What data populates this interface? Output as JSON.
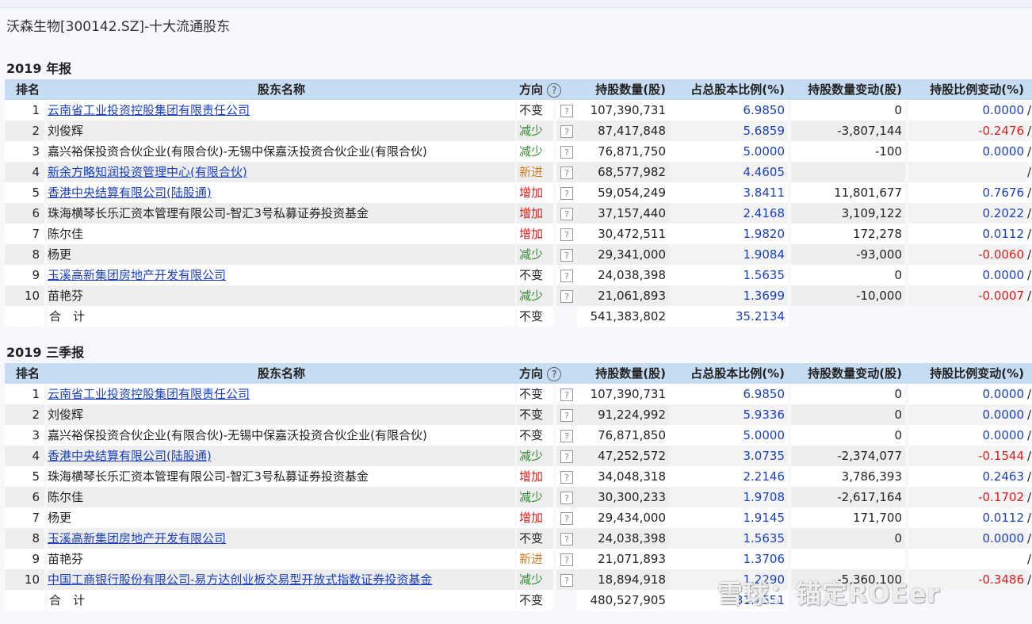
{
  "page_title": "沃森生物[300142.SZ]-十大流通股东",
  "headers": {
    "rank": "排名",
    "name": "股东名称",
    "direction": "方向",
    "help": "?",
    "shares": "持股数量(股)",
    "ratio": "占总股本比例(%)",
    "shares_change": "持股数量变动(股)",
    "ratio_change": "持股比例变动(%)"
  },
  "sections": [
    {
      "title": "2019 年报",
      "rows": [
        {
          "rank": "1",
          "name": "云南省工业投资控股集团有限责任公司",
          "link": true,
          "direction": "不变",
          "dir_color": "dim",
          "shares": "107,390,731",
          "ratio": "6.9850",
          "shares_change": "0",
          "ratio_change": "0.0000",
          "rc_color": "blue",
          "tail": "/"
        },
        {
          "rank": "2",
          "name": "刘俊辉",
          "link": false,
          "direction": "减少",
          "dir_color": "green",
          "shares": "87,417,848",
          "ratio": "5.6859",
          "shares_change": "-3,807,144",
          "ratio_change": "-0.2476",
          "rc_color": "red",
          "tail": "/"
        },
        {
          "rank": "3",
          "name": "嘉兴裕保投资合伙企业(有限合伙)-无锡中保嘉沃投资合伙企业(有限合伙)",
          "link": false,
          "direction": "减少",
          "dir_color": "green",
          "shares": "76,871,750",
          "ratio": "5.0000",
          "shares_change": "-100",
          "ratio_change": "0.0000",
          "rc_color": "blue",
          "tail": "/"
        },
        {
          "rank": "4",
          "name": "新余方略知润投资管理中心(有限合伙)",
          "link": true,
          "direction": "新进",
          "dir_color": "orange",
          "shares": "68,577,982",
          "ratio": "4.4605",
          "shares_change": "",
          "ratio_change": "",
          "rc_color": "blue",
          "tail": "/"
        },
        {
          "rank": "5",
          "name": "香港中央结算有限公司(陆股通)",
          "link": true,
          "direction": "增加",
          "dir_color": "red",
          "shares": "59,054,249",
          "ratio": "3.8411",
          "shares_change": "11,801,677",
          "ratio_change": "0.7676",
          "rc_color": "blue",
          "tail": "/"
        },
        {
          "rank": "6",
          "name": "珠海横琴长乐汇资本管理有限公司-智汇3号私募证券投资基金",
          "link": false,
          "direction": "增加",
          "dir_color": "red",
          "shares": "37,157,440",
          "ratio": "2.4168",
          "shares_change": "3,109,122",
          "ratio_change": "0.2022",
          "rc_color": "blue",
          "tail": "/"
        },
        {
          "rank": "7",
          "name": "陈尔佳",
          "link": false,
          "direction": "增加",
          "dir_color": "red",
          "shares": "30,472,511",
          "ratio": "1.9820",
          "shares_change": "172,278",
          "ratio_change": "0.0112",
          "rc_color": "blue",
          "tail": "/"
        },
        {
          "rank": "8",
          "name": "杨更",
          "link": false,
          "direction": "减少",
          "dir_color": "green",
          "shares": "29,341,000",
          "ratio": "1.9084",
          "shares_change": "-93,000",
          "ratio_change": "-0.0060",
          "rc_color": "red",
          "tail": "/"
        },
        {
          "rank": "9",
          "name": "玉溪高新集团房地产开发有限公司",
          "link": true,
          "direction": "不变",
          "dir_color": "dim",
          "shares": "24,038,398",
          "ratio": "1.5635",
          "shares_change": "0",
          "ratio_change": "0.0000",
          "rc_color": "blue",
          "tail": "/"
        },
        {
          "rank": "10",
          "name": "苗艳芬",
          "link": false,
          "direction": "减少",
          "dir_color": "green",
          "shares": "21,061,893",
          "ratio": "1.3699",
          "shares_change": "-10,000",
          "ratio_change": "-0.0007",
          "rc_color": "red",
          "tail": "/"
        }
      ],
      "total": {
        "label": "合　计",
        "direction": "不变",
        "shares": "541,383,802",
        "ratio": "35.2134"
      }
    },
    {
      "title": "2019 三季报",
      "rows": [
        {
          "rank": "1",
          "name": "云南省工业投资控股集团有限责任公司",
          "link": true,
          "direction": "不变",
          "dir_color": "dim",
          "shares": "107,390,731",
          "ratio": "6.9850",
          "shares_change": "0",
          "ratio_change": "0.0000",
          "rc_color": "blue",
          "tail": "/"
        },
        {
          "rank": "2",
          "name": "刘俊辉",
          "link": false,
          "direction": "不变",
          "dir_color": "dim",
          "shares": "91,224,992",
          "ratio": "5.9336",
          "shares_change": "0",
          "ratio_change": "0.0000",
          "rc_color": "blue",
          "tail": "/"
        },
        {
          "rank": "3",
          "name": "嘉兴裕保投资合伙企业(有限合伙)-无锡中保嘉沃投资合伙企业(有限合伙)",
          "link": false,
          "direction": "不变",
          "dir_color": "dim",
          "shares": "76,871,850",
          "ratio": "5.0000",
          "shares_change": "0",
          "ratio_change": "0.0000",
          "rc_color": "blue",
          "tail": "/"
        },
        {
          "rank": "4",
          "name": "香港中央结算有限公司(陆股通)",
          "link": true,
          "direction": "减少",
          "dir_color": "green",
          "shares": "47,252,572",
          "ratio": "3.0735",
          "shares_change": "-2,374,077",
          "ratio_change": "-0.1544",
          "rc_color": "red",
          "tail": "/"
        },
        {
          "rank": "5",
          "name": "珠海横琴长乐汇资本管理有限公司-智汇3号私募证券投资基金",
          "link": false,
          "direction": "增加",
          "dir_color": "red",
          "shares": "34,048,318",
          "ratio": "2.2146",
          "shares_change": "3,786,393",
          "ratio_change": "0.2463",
          "rc_color": "blue",
          "tail": "/"
        },
        {
          "rank": "6",
          "name": "陈尔佳",
          "link": false,
          "direction": "减少",
          "dir_color": "green",
          "shares": "30,300,233",
          "ratio": "1.9708",
          "shares_change": "-2,617,164",
          "ratio_change": "-0.1702",
          "rc_color": "red",
          "tail": "/"
        },
        {
          "rank": "7",
          "name": "杨更",
          "link": false,
          "direction": "增加",
          "dir_color": "red",
          "shares": "29,434,000",
          "ratio": "1.9145",
          "shares_change": "171,700",
          "ratio_change": "0.0112",
          "rc_color": "blue",
          "tail": "/"
        },
        {
          "rank": "8",
          "name": "玉溪高新集团房地产开发有限公司",
          "link": true,
          "direction": "不变",
          "dir_color": "dim",
          "shares": "24,038,398",
          "ratio": "1.5635",
          "shares_change": "0",
          "ratio_change": "0.0000",
          "rc_color": "blue",
          "tail": "/"
        },
        {
          "rank": "9",
          "name": "苗艳芬",
          "link": false,
          "direction": "新进",
          "dir_color": "orange",
          "shares": "21,071,893",
          "ratio": "1.3706",
          "shares_change": "",
          "ratio_change": "",
          "rc_color": "blue",
          "tail": "/"
        },
        {
          "rank": "10",
          "name": "中国工商银行股份有限公司-易方达创业板交易型开放式指数证券投资基金",
          "link": true,
          "direction": "减少",
          "dir_color": "green",
          "shares": "18,894,918",
          "ratio": "1.2290",
          "shares_change": "-5,360,100",
          "ratio_change": "-0.3486",
          "rc_color": "red",
          "tail": "/"
        }
      ],
      "total": {
        "label": "合　计",
        "direction": "不变",
        "shares": "480,527,905",
        "ratio": "31.2551"
      }
    }
  ],
  "watermark": "雪球：锚定ROEer"
}
